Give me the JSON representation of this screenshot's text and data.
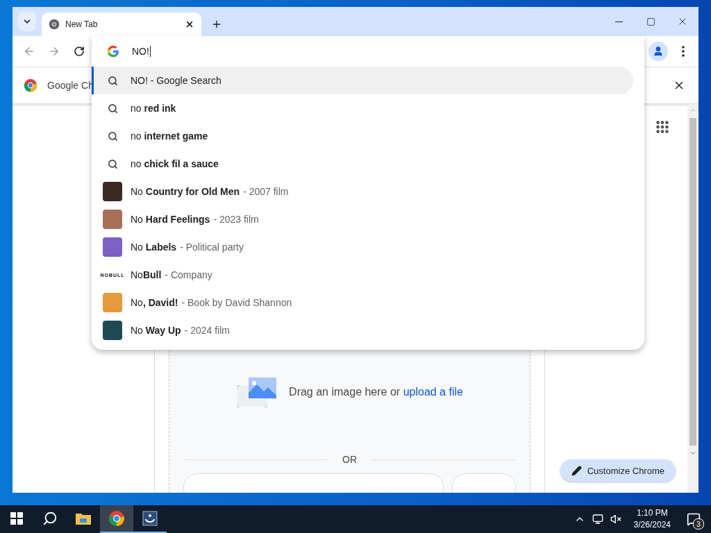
{
  "window": {
    "tabs": [
      {
        "title": "New Tab",
        "selected": true
      }
    ]
  },
  "omnibox": {
    "value": "NO!"
  },
  "suggestions": [
    {
      "kind": "search",
      "text": "NO! - Google Search",
      "selected": true
    },
    {
      "kind": "search",
      "text": "no **red ink**",
      "selected": false
    },
    {
      "kind": "search",
      "text": "no **internet game**",
      "selected": false
    },
    {
      "kind": "search",
      "text": "no **chick fil a sauce**",
      "selected": false
    },
    {
      "kind": "entity",
      "text": "No **Country for Old Men**",
      "detail": "- 2007 film",
      "thumbnail": {
        "kind": "photo",
        "color": "#3b2a22"
      },
      "selected": false
    },
    {
      "kind": "entity",
      "text": "No **Hard Feelings**",
      "detail": "- 2023 film",
      "thumbnail": {
        "kind": "photo",
        "color": "#a8705a"
      },
      "selected": false
    },
    {
      "kind": "entity",
      "text": "No **Labels**",
      "detail": "- Political party",
      "thumbnail": {
        "kind": "photo",
        "color": "#7b62c4"
      },
      "selected": false
    },
    {
      "kind": "entity",
      "text": "No**Bull**",
      "detail": "- Company",
      "thumbnail": {
        "kind": "logo",
        "text": "NOBULL"
      },
      "selected": false
    },
    {
      "kind": "entity",
      "text": "No**, David!**",
      "detail": "- Book by David Shannon",
      "thumbnail": {
        "kind": "photo",
        "color": "#e59a3c"
      },
      "selected": false
    },
    {
      "kind": "entity",
      "text": "No **Way Up**",
      "detail": "- 2024 film",
      "thumbnail": {
        "kind": "photo",
        "color": "#1f4a55"
      },
      "selected": false
    }
  ],
  "info_bar": {
    "text": "Google Ch"
  },
  "image_search": {
    "prompt": "Drag an image here or",
    "link": "upload a file",
    "divider": "OR"
  },
  "customize_button": {
    "label": "Customize Chrome"
  },
  "taskbar": {
    "apps": [
      {
        "kind": "explorer",
        "selected": false,
        "open": false
      },
      {
        "kind": "chrome",
        "selected": true,
        "open": true
      },
      {
        "kind": "app",
        "selected": false,
        "open": true
      }
    ],
    "clock": {
      "time": "1:10 PM",
      "date": "3/26/2024"
    },
    "notifications": "3"
  }
}
